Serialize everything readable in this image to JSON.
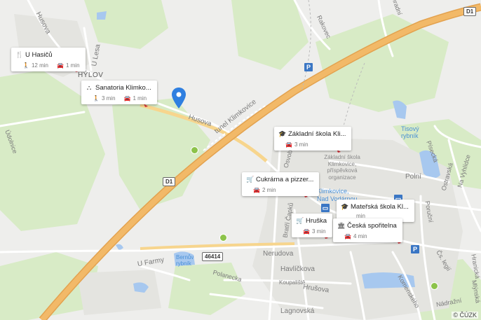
{
  "map": {
    "copyright": "© ČÚZK",
    "roads": {
      "husova_nw": "Husova",
      "u_lesa": "U Lesa",
      "husova": "Husova",
      "tunel": "tunel Klimkovice",
      "radkovec": "Rakovec",
      "d1_top": "D1",
      "d1_mid": "D1",
      "road_46414": "46414",
      "u_farmy": "U Farmy",
      "nerudova": "Nerudova",
      "havlickova": "Havlíčkova",
      "polanecka": "Polanecka",
      "lagnovska": "Lagnovská",
      "kupaliste": "Koupaliště",
      "hrusova": "Hrušova",
      "bratri_capku": "Bratří Čapků",
      "polni": "Polní",
      "pisecka": "Písecká",
      "ostravska": "Ostravská",
      "na_vyhlidce": "Na Vyhlídce",
      "porucni": "Poruční",
      "cs_legii": "Čs. legií",
      "hranicka": "Hranická",
      "mlynska": "Mlýnská",
      "komenskeho": "Komenského",
      "nadrazni": "Nádražní",
      "osvobozeni": "Osvobození",
      "hylov": "HÝLOV",
      "ldonice": "Údolnice",
      "buchlovice": "Zahradní"
    },
    "water": {
      "tisovy": "Tisový rybník",
      "bernuv": "Bernův rybník"
    },
    "poi_text": {
      "school_area": "Základní škola Klimkovice, příspěvková organizace",
      "station": "Klimkovice, Nad Vodárnou"
    },
    "cards": [
      {
        "icon": "fork-knife-icon",
        "glyph": "🍴",
        "title": "U Hasičů",
        "walk": "12 min",
        "car": "1 min"
      },
      {
        "icon": "sanatorium-icon",
        "glyph": "⛬",
        "title": "Sanatoria Klimko...",
        "walk": "3 min",
        "car": "1 min"
      },
      {
        "icon": "graduation-cap-icon",
        "glyph": "🎓",
        "title": "Základní škola Kli...",
        "car": "3 min"
      },
      {
        "icon": "cart-icon",
        "glyph": "🛒",
        "title": "Cukrárna a pizzer...",
        "car": "2 min"
      },
      {
        "icon": "graduation-cap-icon",
        "glyph": "🎓",
        "title": "Mateřská škola Kl...",
        "car": "min"
      },
      {
        "icon": "cart-icon",
        "glyph": "🛒",
        "title": "Hruška",
        "car": "3 min"
      },
      {
        "icon": "bank-icon",
        "glyph": "🏛",
        "title": "Česká spořitelna",
        "car": "4 min"
      }
    ],
    "colors": {
      "motorway": "#f2b968",
      "motorway_edge": "#e3a24f",
      "road": "#ffffff",
      "green": "#d8ebc6",
      "water": "#a7c8ef",
      "pin": "#2f7fe0"
    }
  }
}
